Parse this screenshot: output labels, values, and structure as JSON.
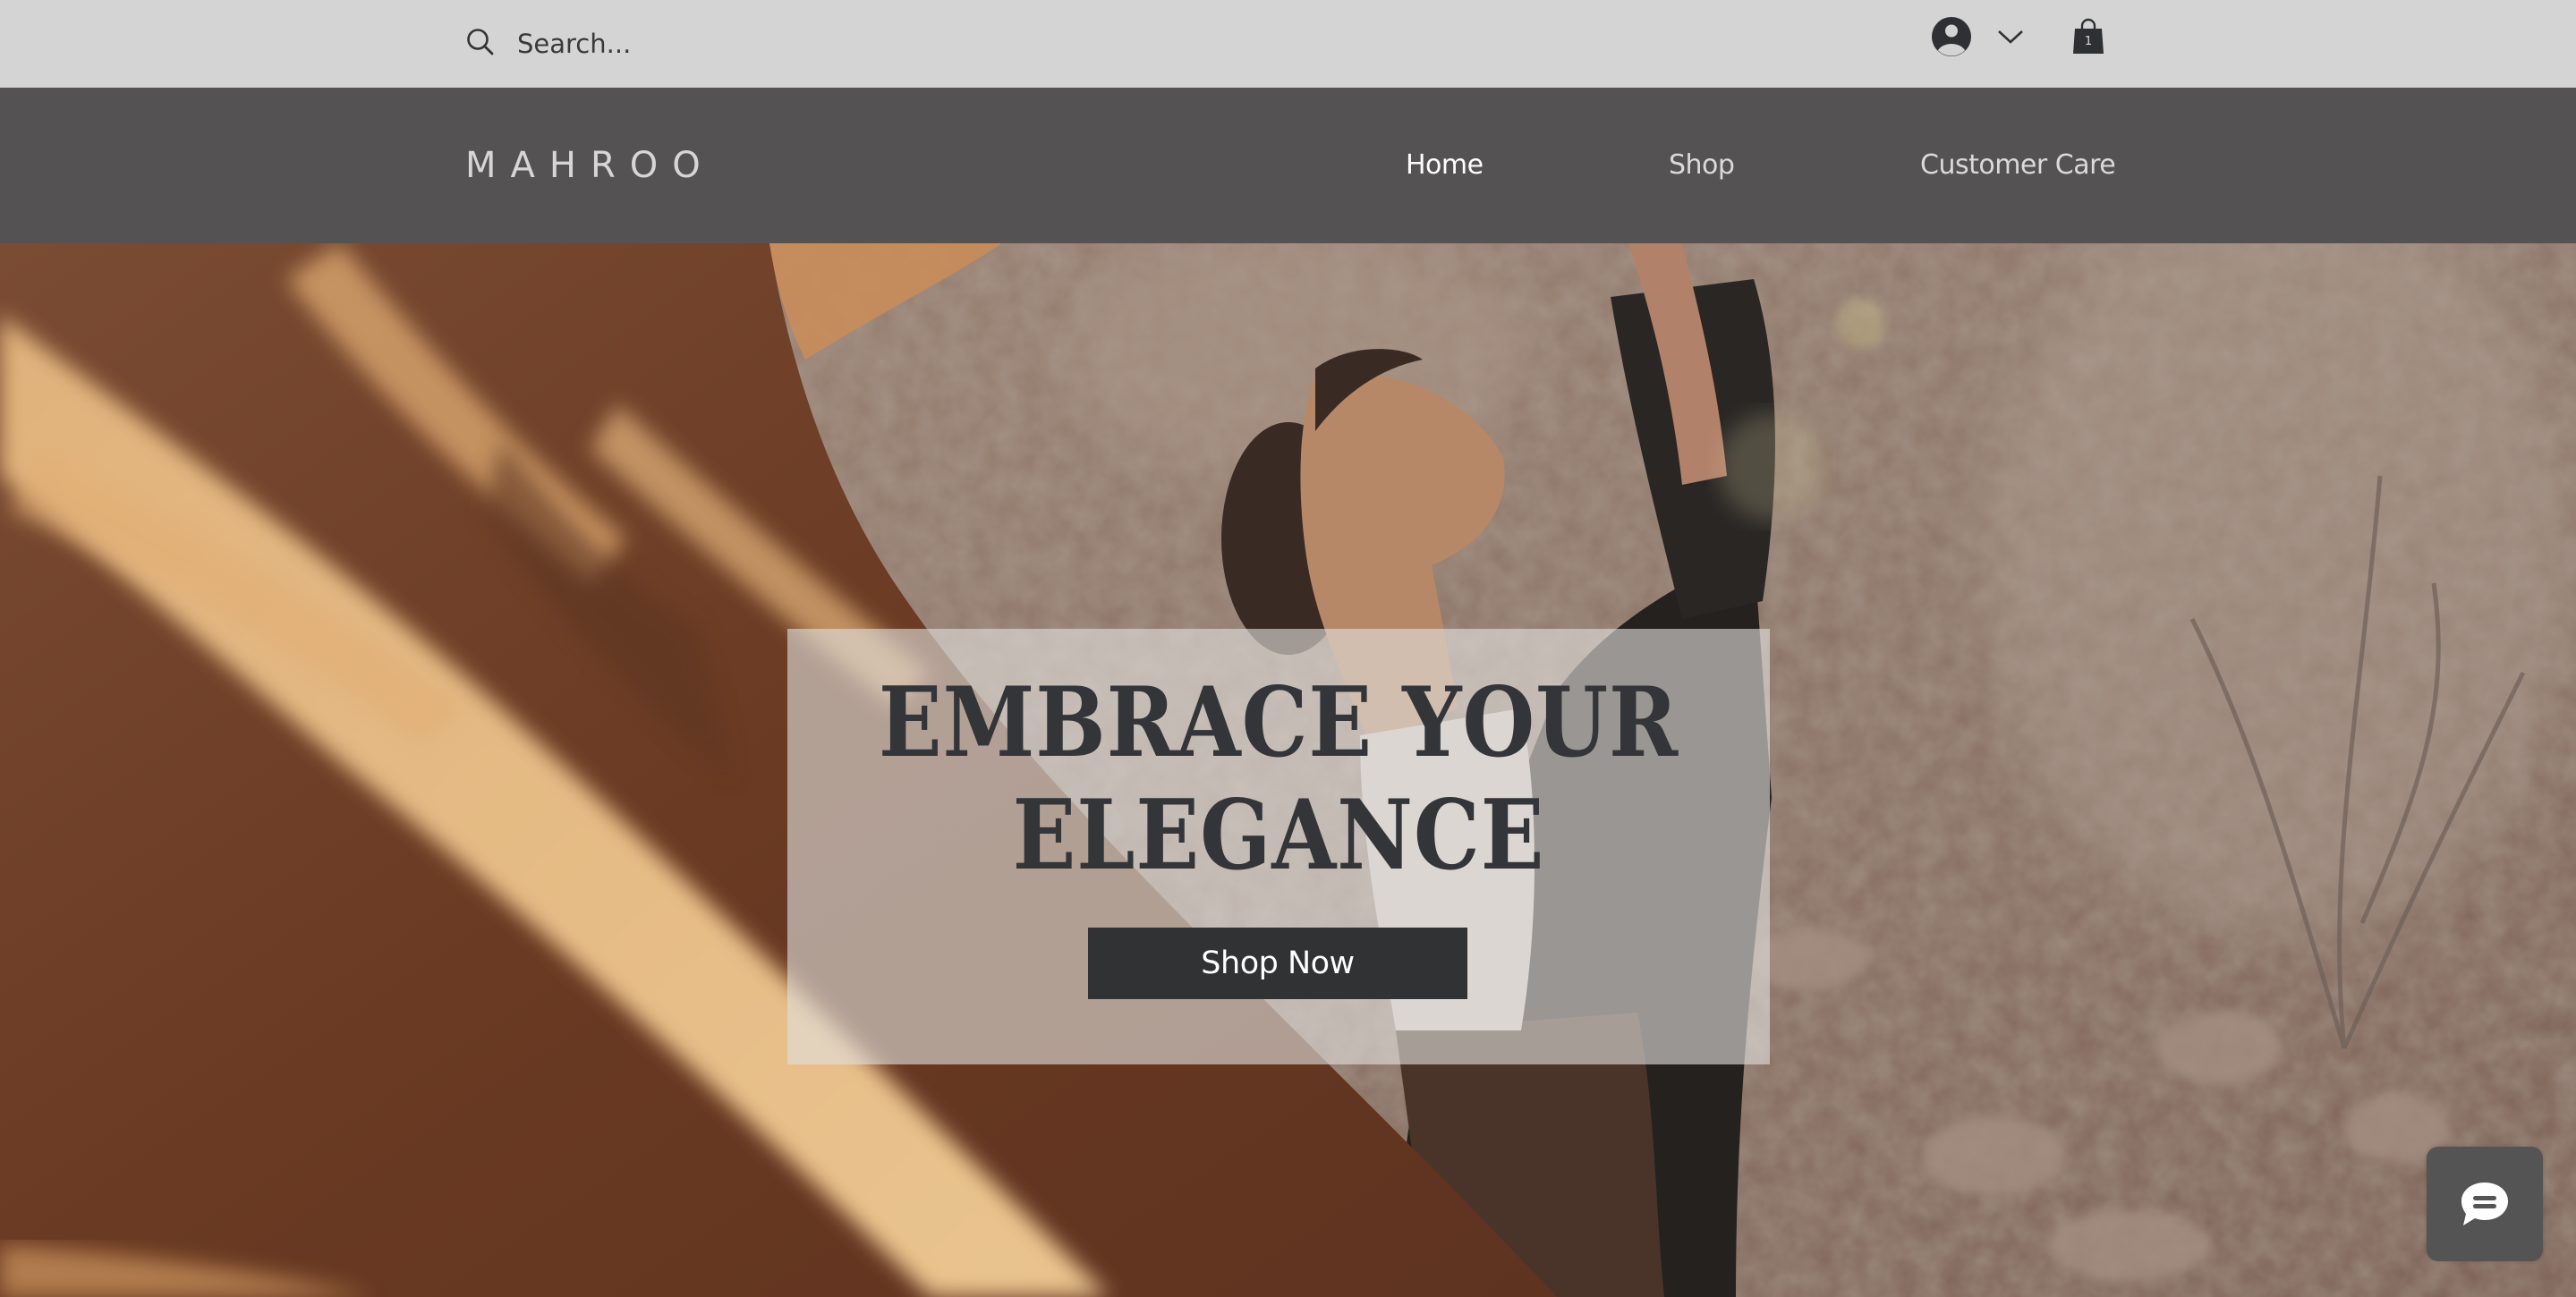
{
  "topbar": {
    "search": {
      "icon": "search-icon",
      "placeholder": "Search...",
      "value": ""
    },
    "account": {
      "icon": "user-avatar-icon",
      "dropdown_icon": "chevron-down-icon"
    },
    "cart": {
      "icon": "shopping-bag-icon",
      "count": "1"
    }
  },
  "navbar": {
    "logo": "MAHROO",
    "items": [
      {
        "label": "Home",
        "active": true
      },
      {
        "label": "Shop",
        "active": false
      },
      {
        "label": "Customer Care",
        "active": false
      }
    ]
  },
  "hero": {
    "headline_line1": "EMBRACE YOUR",
    "headline_line2": "ELEGANCE",
    "cta_label": "Shop Now",
    "background_image": "woman-in-desert-with-flowing-fabric"
  },
  "chat_widget": {
    "icon": "chat-bubble-icon"
  },
  "colors": {
    "topbar_bg": "#d4d4d4",
    "navbar_bg": "#545253",
    "text_dark": "#333538",
    "button_bg": "#303234",
    "chat_bg": "#545454"
  }
}
